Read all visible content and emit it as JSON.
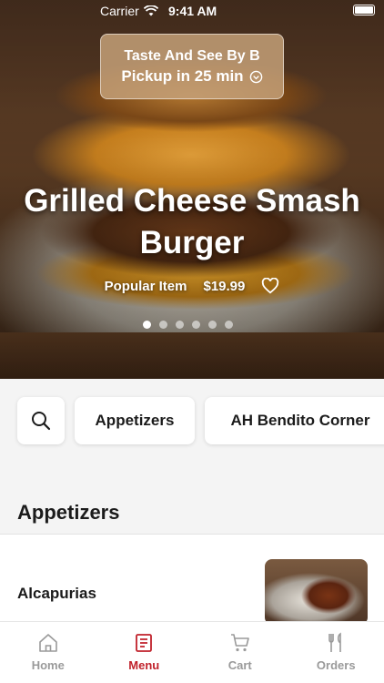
{
  "status_bar": {
    "carrier": "Carrier",
    "time": "9:41 AM"
  },
  "pickup": {
    "store": "Taste And See By B",
    "eta": "Pickup in 25 min"
  },
  "hero": {
    "title": "Grilled Cheese Smash Burger",
    "tag": "Popular Item",
    "price": "$19.99",
    "carousel_count": 6,
    "carousel_active": 1
  },
  "categories": [
    {
      "label": "Appetizers"
    },
    {
      "label": "AH Bendito Corner"
    }
  ],
  "section": {
    "title": "Appetizers"
  },
  "items": [
    {
      "name": "Alcapurias"
    }
  ],
  "tabs": [
    {
      "label": "Home",
      "icon": "home-icon"
    },
    {
      "label": "Menu",
      "icon": "menu-icon",
      "active": true
    },
    {
      "label": "Cart",
      "icon": "cart-icon"
    },
    {
      "label": "Orders",
      "icon": "orders-icon"
    }
  ],
  "colors": {
    "accent": "#c0212b",
    "inactive_tab": "#9a9a9a"
  }
}
